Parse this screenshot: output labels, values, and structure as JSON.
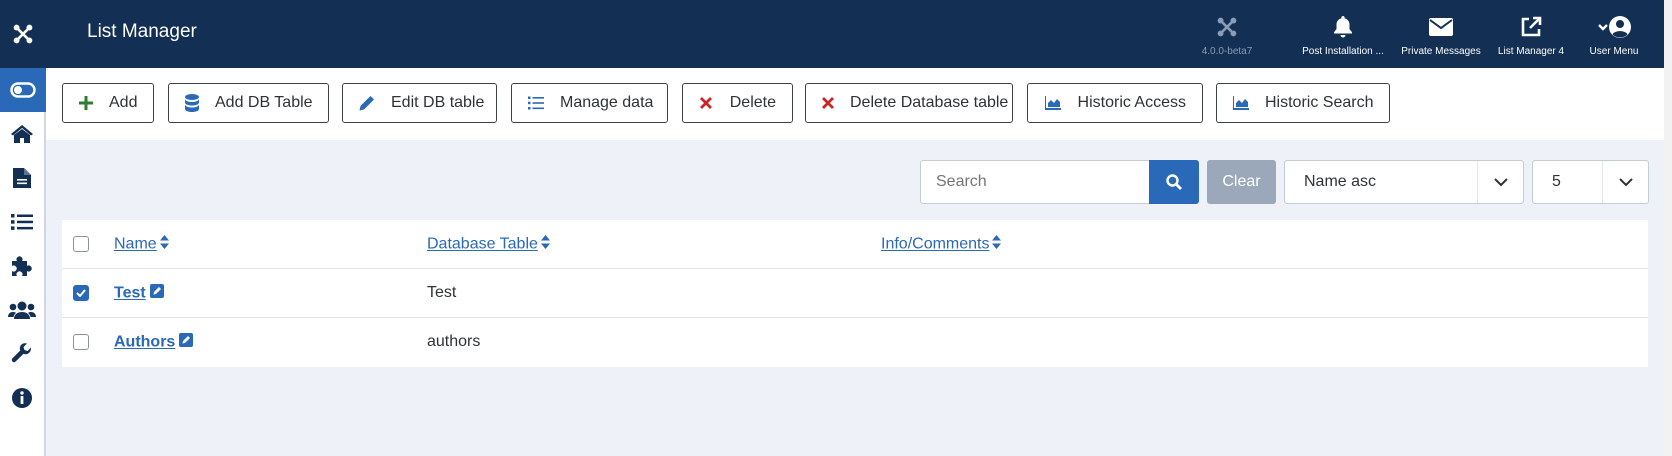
{
  "header": {
    "title": "List Manager",
    "items": [
      {
        "label": "4.0.0-beta7",
        "icon": "joomla-icon"
      },
      {
        "label": "Post Installation ...",
        "icon": "bell-icon"
      },
      {
        "label": "Private Messages",
        "icon": "envelope-icon"
      },
      {
        "label": "List Manager 4",
        "icon": "external-link-icon"
      },
      {
        "label": "User Menu",
        "icon": "user-icon"
      }
    ]
  },
  "sidebar": {
    "items": [
      "toggle-icon",
      "home-icon",
      "document-icon",
      "list-icon",
      "puzzle-icon",
      "users-icon",
      "wrench-icon",
      "info-icon"
    ]
  },
  "toolbar": {
    "add": "Add",
    "add_db_table": "Add DB Table",
    "edit_db_table": "Edit DB table",
    "manage_data": "Manage data",
    "delete": "Delete",
    "delete_db_table": "Delete Database table",
    "historic_access": "Historic Access",
    "historic_search": "Historic Search"
  },
  "filters": {
    "search_placeholder": "Search",
    "clear": "Clear",
    "ordering": "Name asc",
    "limit": "5"
  },
  "table": {
    "columns": [
      "Name",
      "Database Table",
      "Info/Comments"
    ],
    "rows": [
      {
        "name": "Test",
        "db_table": "Test",
        "info": "",
        "checked": true
      },
      {
        "name": "Authors",
        "db_table": "authors",
        "info": "",
        "checked": false
      }
    ]
  },
  "colors": {
    "header_bg": "#132f53",
    "primary": "#2a69b8",
    "danger": "#c52827",
    "success": "#2f7d32"
  }
}
